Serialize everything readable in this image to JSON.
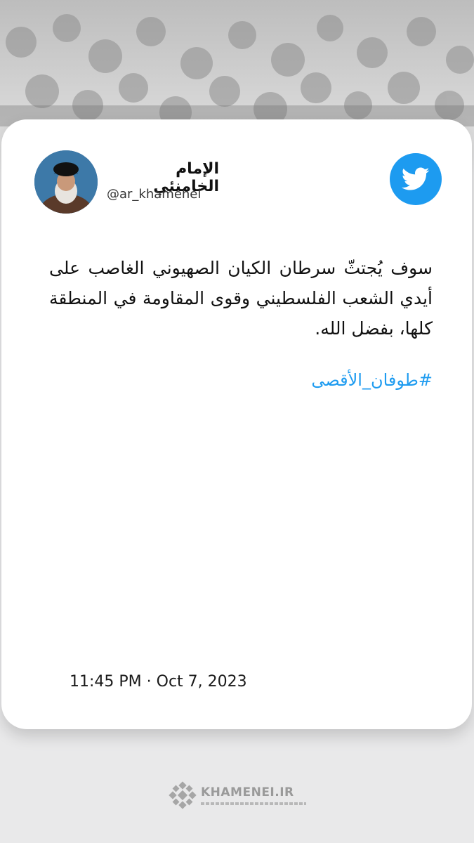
{
  "author": {
    "name": "الإمام الخامنئي",
    "handle": "@ar_khamenei"
  },
  "tweet": {
    "text": "سوف يُجتثّ سرطان الكيان الصهيوني الغاصب على أيدي الشعب الفلسطيني وقوى المقاومة في المنطقة كلها، بفضل الله.",
    "hashtag": "#طوفان_الأقصى",
    "timestamp": "11:45 PM · Oct 7, 2023"
  },
  "branding": {
    "logo_text": "KHAMENEI.IR"
  },
  "icons": {
    "platform": "twitter-bird-icon",
    "avatar": "profile-photo",
    "logo": "khamenei-logo-icon"
  },
  "colors": {
    "accent": "#1d9bf0",
    "card": "#ffffff",
    "background": "#e9e9ea"
  }
}
